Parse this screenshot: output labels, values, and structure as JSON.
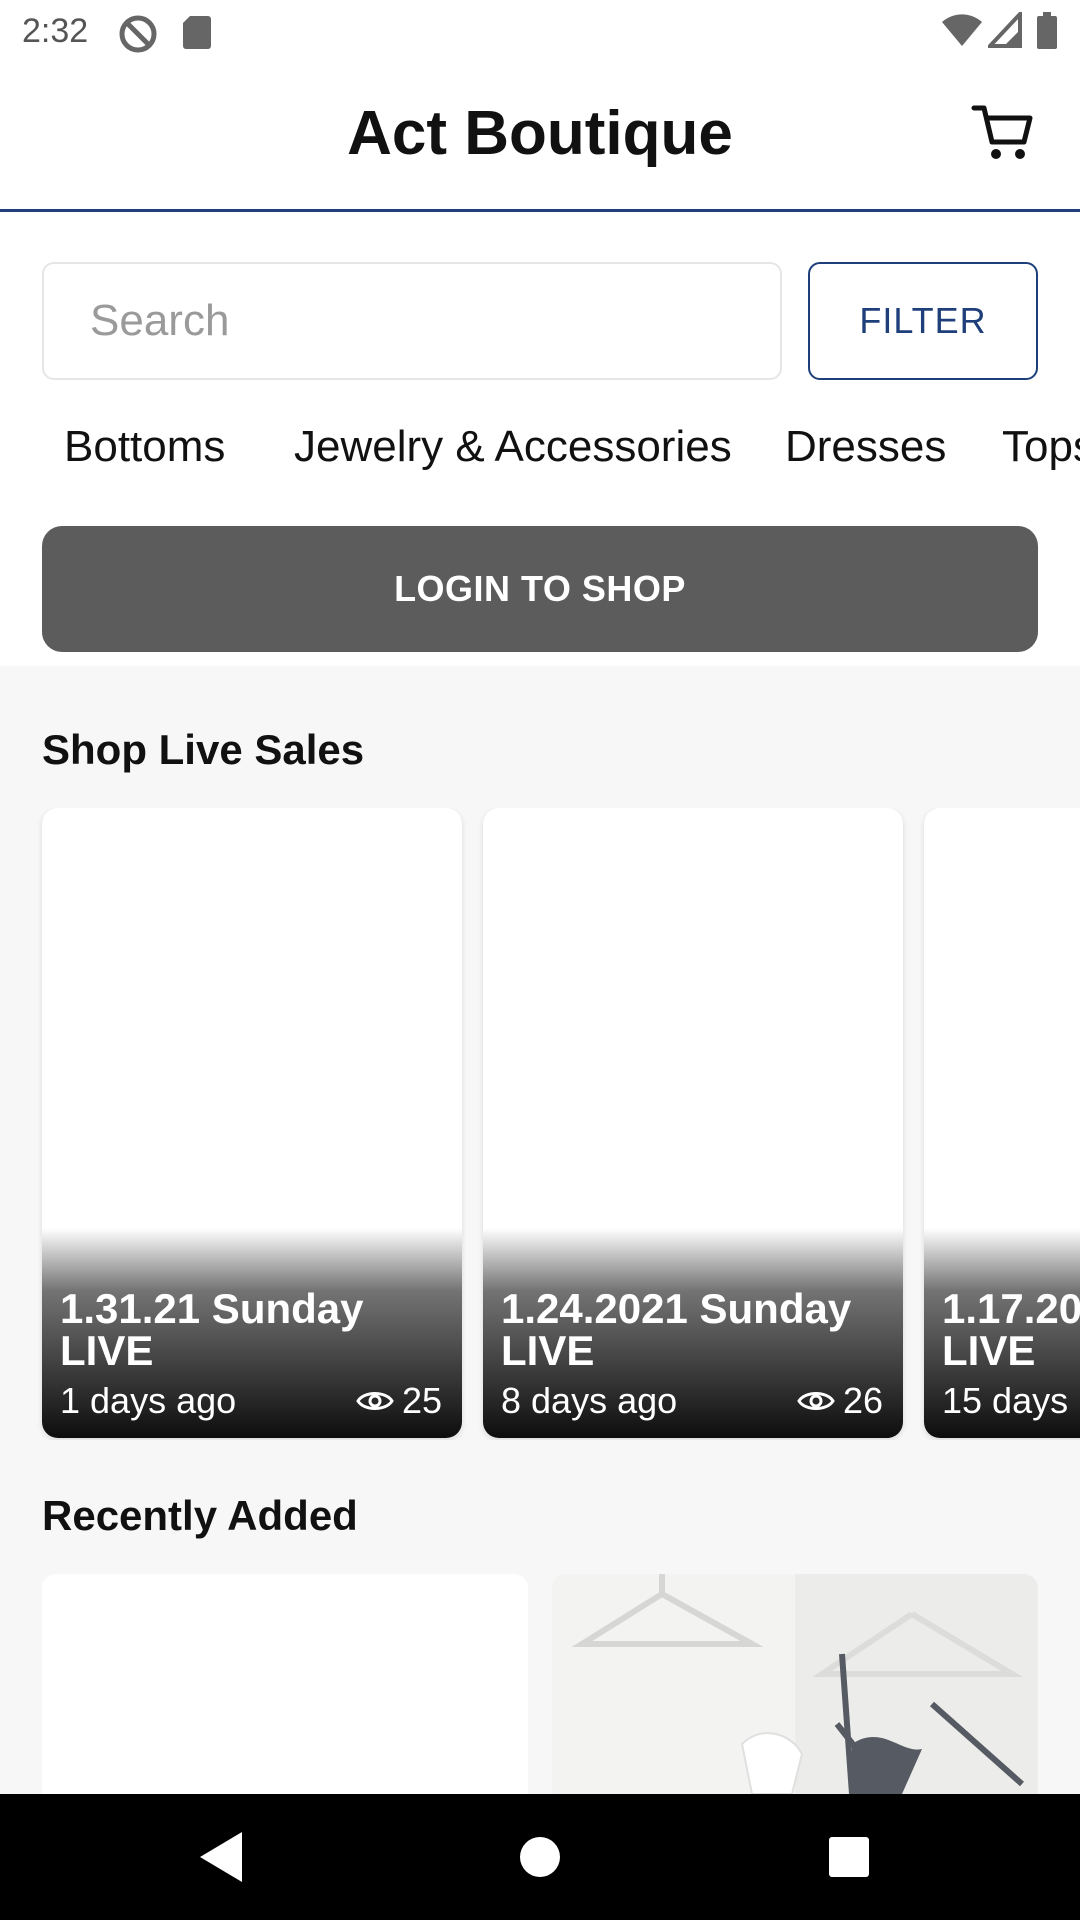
{
  "status_bar": {
    "time": "2:32",
    "icons": [
      "at-sign-icon",
      "sd-card-icon",
      "wifi-icon",
      "signal-icon",
      "battery-icon"
    ]
  },
  "header": {
    "title": "Act Boutique",
    "cart_icon": "shopping-cart-icon"
  },
  "search": {
    "placeholder": "Search",
    "value": ""
  },
  "filter_button": {
    "label": "FILTER"
  },
  "categories": [
    "Bottoms",
    "Jewelry & Accessories",
    "Dresses",
    "Tops"
  ],
  "login_button": {
    "label": "LOGIN TO SHOP"
  },
  "live_sales": {
    "title": "Shop Live Sales",
    "cards": [
      {
        "title_line1": "1.31.21 Sunday",
        "title_line2": "LIVE",
        "ago": "1 days ago",
        "views": "25"
      },
      {
        "title_line1": "1.24.2021 Sunday",
        "title_line2": "LIVE",
        "ago": "8 days ago",
        "views": "26"
      },
      {
        "title_line1": "1.17.20",
        "title_line2": "LIVE",
        "ago": "15 days",
        "views": ""
      }
    ]
  },
  "recently_added": {
    "title": "Recently Added"
  },
  "colors": {
    "accent": "#1f3f7a",
    "login_button": "#5c5c5c",
    "background": "#f7f7f7"
  }
}
